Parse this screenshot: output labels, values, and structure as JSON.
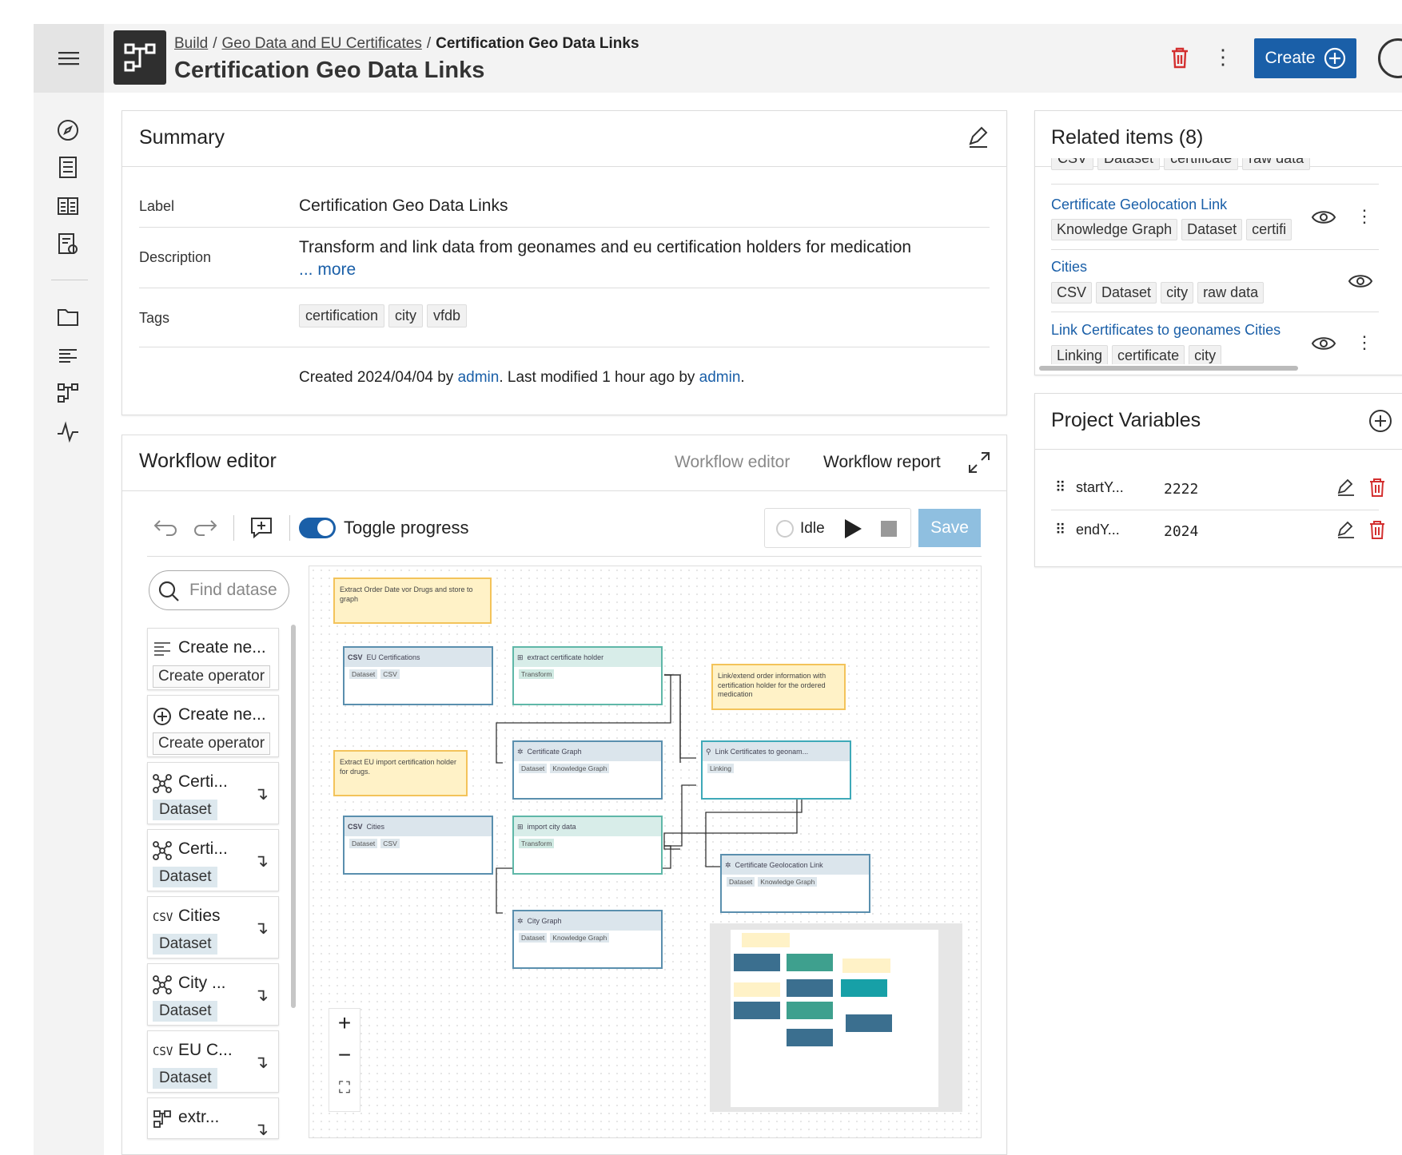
{
  "header": {
    "breadcrumb": [
      "Build",
      "Geo Data and EU Certificates",
      "Certification Geo Data Links"
    ],
    "title": "Certification Geo Data Links",
    "create_label": "Create"
  },
  "summary": {
    "heading": "Summary",
    "label_key": "Label",
    "label_value": "Certification Geo Data Links",
    "description_key": "Description",
    "description_value": "Transform and link data from geonames and eu certification holders for medication",
    "more_label": "... more",
    "tags_key": "Tags",
    "tags": [
      "certification",
      "city",
      "vfdb"
    ],
    "created_prefix": "Created 2024/04/04 by ",
    "created_user": "admin",
    "modified_text": ". Last modified 1 hour ago by ",
    "modified_user": "admin",
    "period": "."
  },
  "workflow": {
    "heading": "Workflow editor",
    "tab_editor": "Workflow editor",
    "tab_report": "Workflow report",
    "toggle_label": "Toggle progress",
    "status": "Idle",
    "save_label": "Save",
    "search_placeholder": "Find datase",
    "sidebar": [
      {
        "title": "Create ne...",
        "chip": "Create operator"
      },
      {
        "title": "Create ne...",
        "chip": "Create operator"
      },
      {
        "title": "Certi...",
        "chip": "Dataset"
      },
      {
        "title": "Certi...",
        "chip": "Dataset"
      },
      {
        "title": "Cities",
        "chip": "Dataset"
      },
      {
        "title": "City ...",
        "chip": "Dataset"
      },
      {
        "title": "EU C...",
        "chip": "Dataset"
      },
      {
        "title": "extr...",
        "chip": ""
      }
    ],
    "notes": [
      "Extract Order Date vor Drugs and store to graph",
      "Link/extend order information with certification holder for the ordered medication",
      "Extract EU import certification holder for drugs."
    ],
    "nodes": [
      {
        "title": "EU Certifications",
        "tags": [
          "Dataset",
          "CSV"
        ]
      },
      {
        "title": "extract certificate holder",
        "tags": [
          "Transform"
        ]
      },
      {
        "title": "Certificate Graph",
        "tags": [
          "Dataset",
          "Knowledge Graph"
        ]
      },
      {
        "title": "Link Certificates to geonam...",
        "tags": [
          "Linking"
        ]
      },
      {
        "title": "Cities",
        "tags": [
          "Dataset",
          "CSV"
        ]
      },
      {
        "title": "import city data",
        "tags": [
          "Transform"
        ]
      },
      {
        "title": "Certificate Geolocation Link",
        "tags": [
          "Dataset",
          "Knowledge Graph"
        ]
      },
      {
        "title": "City Graph",
        "tags": [
          "Dataset",
          "Knowledge Graph"
        ]
      }
    ]
  },
  "related": {
    "heading": "Related items (8)",
    "top_tags": [
      "CSV",
      "Dataset",
      "certificate",
      "raw data"
    ],
    "items": [
      {
        "title": "Certificate Geolocation Link",
        "tags": [
          "Knowledge Graph",
          "Dataset",
          "certifi"
        ]
      },
      {
        "title": "Cities",
        "tags": [
          "CSV",
          "Dataset",
          "city",
          "raw data"
        ]
      },
      {
        "title": "Link Certificates to geonames Cities",
        "tags": [
          "Linking",
          "certificate",
          "city"
        ]
      }
    ]
  },
  "variables": {
    "heading": "Project Variables",
    "items": [
      {
        "name": "startY...",
        "value": "2222"
      },
      {
        "name": "endY...",
        "value": "2024"
      }
    ]
  },
  "colors": {
    "accent": "#1a5fa8",
    "danger": "#d32f2f",
    "save_disabled": "#8fbfe0"
  }
}
